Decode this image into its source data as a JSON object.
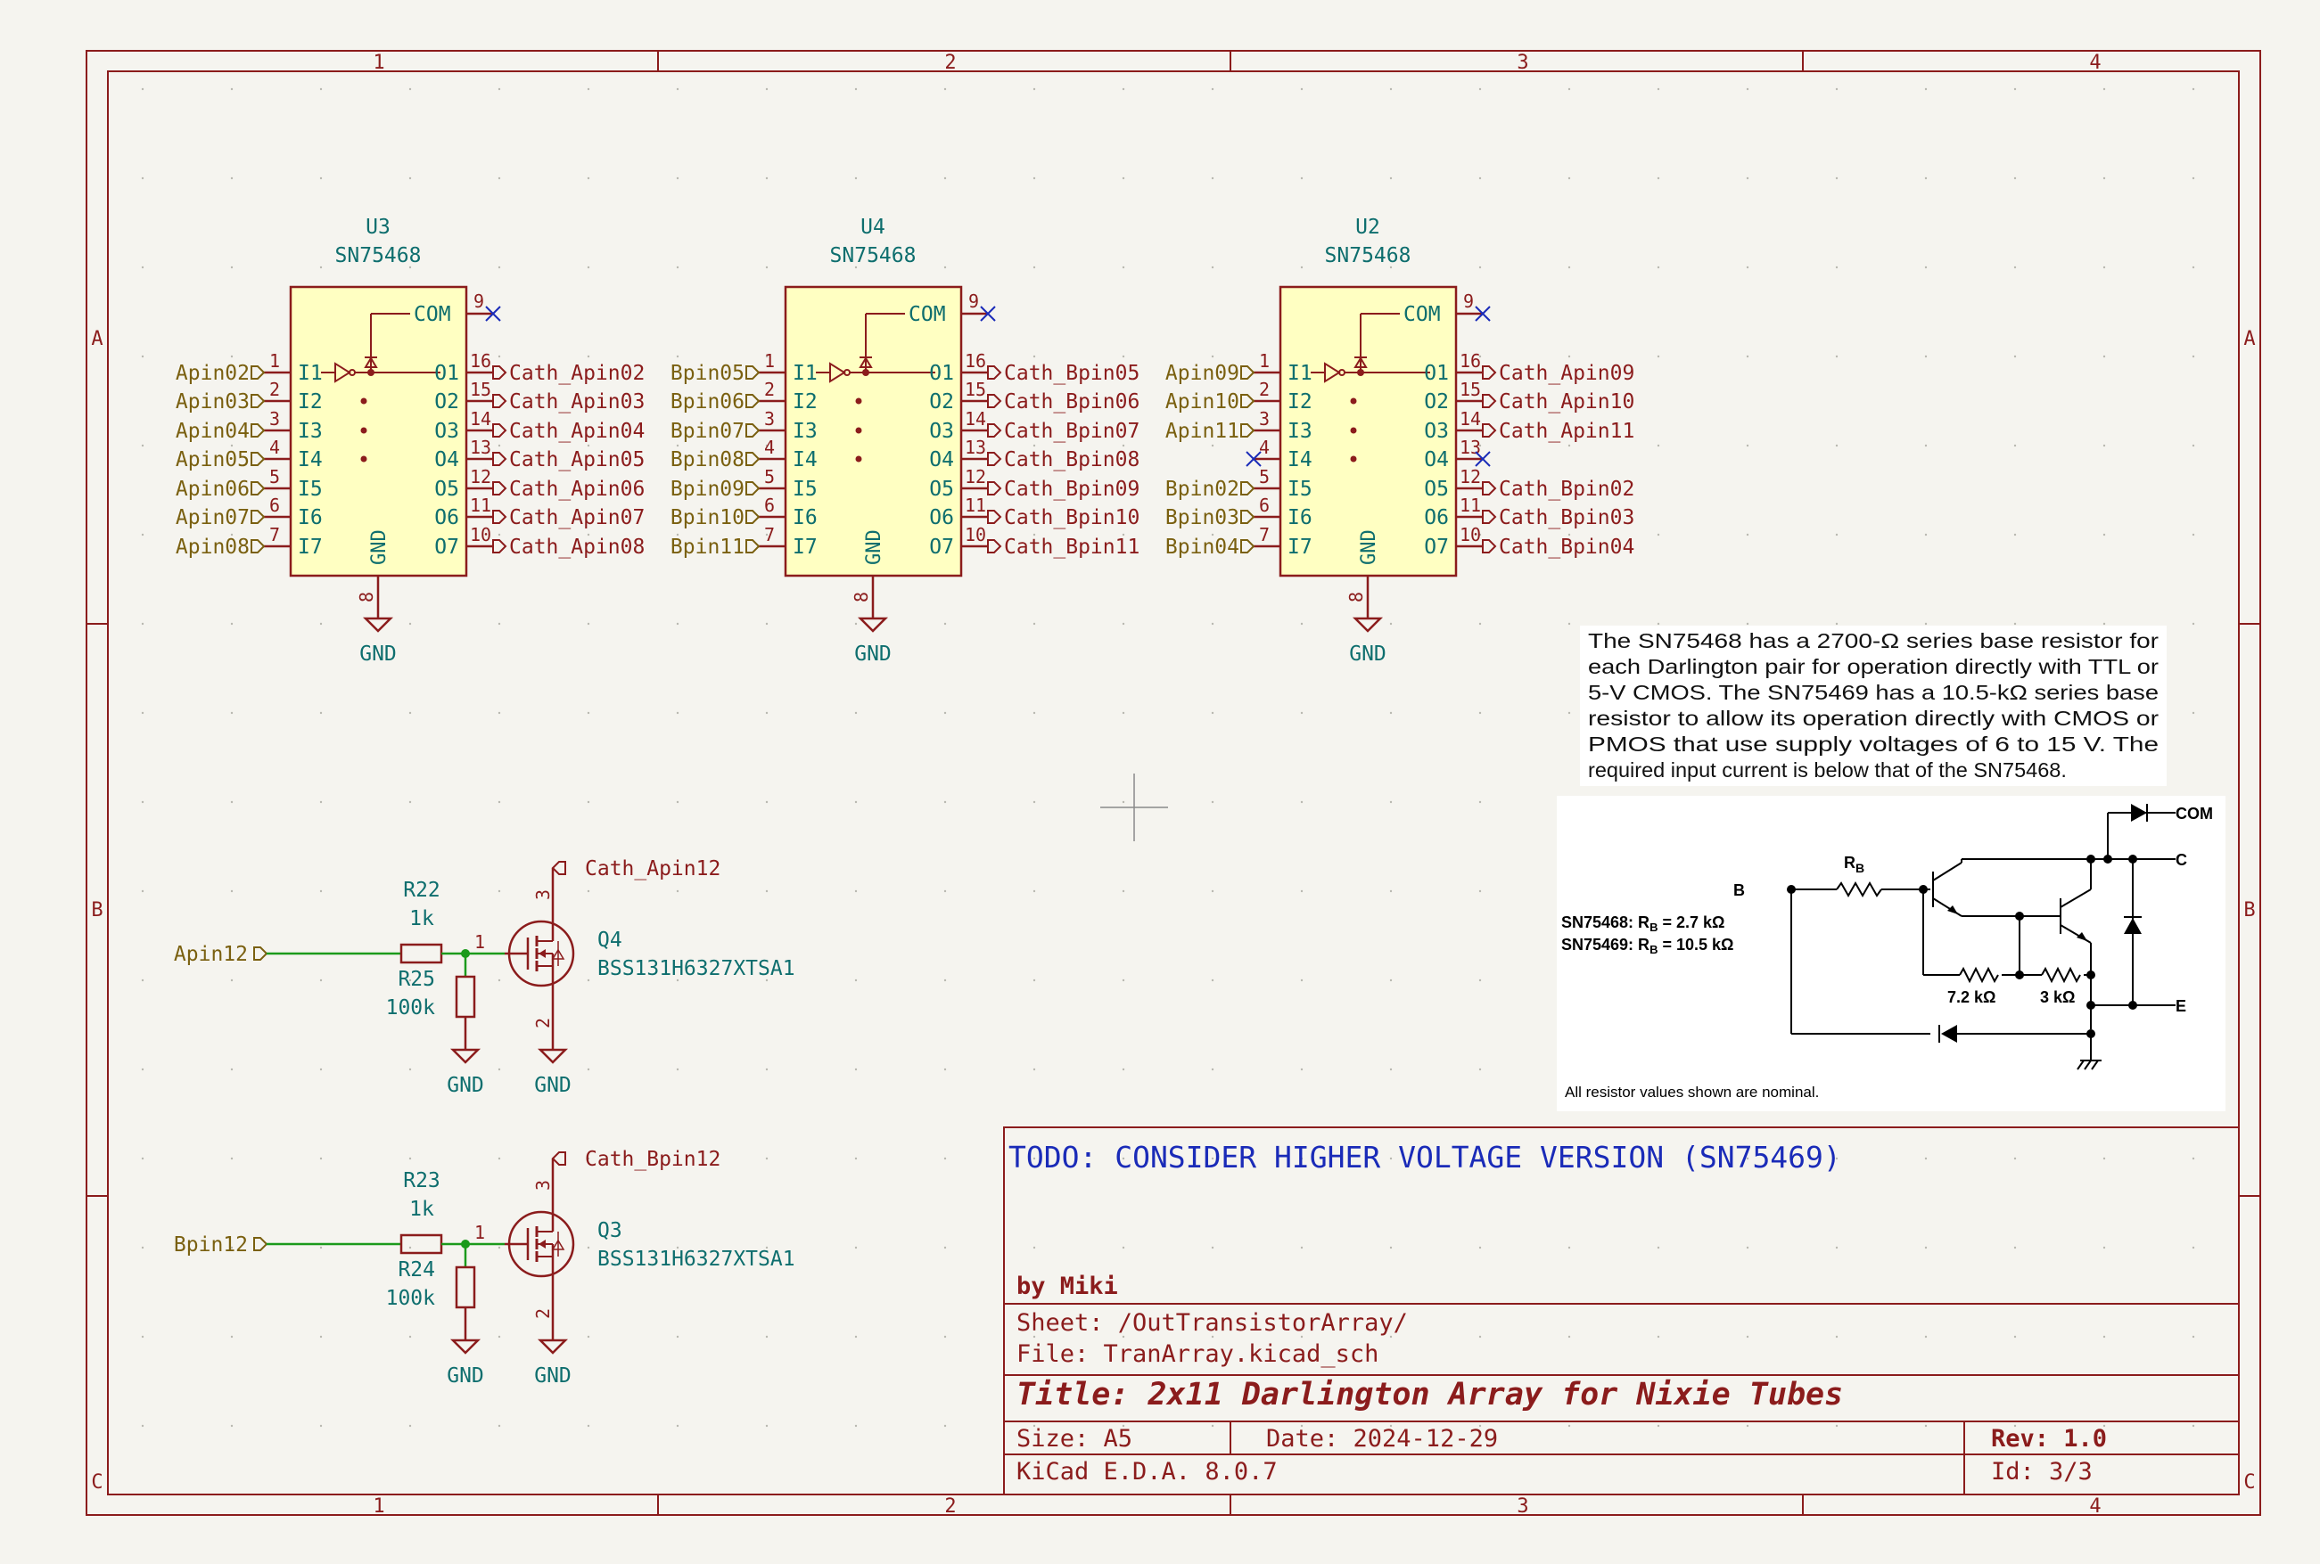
{
  "frame": {
    "columns": [
      "1",
      "2",
      "3",
      "4"
    ],
    "rows": [
      "A",
      "B",
      "C"
    ]
  },
  "ics": [
    {
      "ref": "U3",
      "value": "SN75468",
      "com_label": "COM",
      "com_pin": "9",
      "gnd_label": "GND",
      "gnd_pin": "8",
      "power": "GND",
      "inputs": [
        {
          "pin": "1",
          "name": "I1",
          "net": "Apin02"
        },
        {
          "pin": "2",
          "name": "I2",
          "net": "Apin03"
        },
        {
          "pin": "3",
          "name": "I3",
          "net": "Apin04"
        },
        {
          "pin": "4",
          "name": "I4",
          "net": "Apin05"
        },
        {
          "pin": "5",
          "name": "I5",
          "net": "Apin06"
        },
        {
          "pin": "6",
          "name": "I6",
          "net": "Apin07"
        },
        {
          "pin": "7",
          "name": "I7",
          "net": "Apin08"
        }
      ],
      "outputs": [
        {
          "pin": "16",
          "name": "O1",
          "net": "Cath_Apin02"
        },
        {
          "pin": "15",
          "name": "O2",
          "net": "Cath_Apin03"
        },
        {
          "pin": "14",
          "name": "O3",
          "net": "Cath_Apin04"
        },
        {
          "pin": "13",
          "name": "O4",
          "net": "Cath_Apin05"
        },
        {
          "pin": "12",
          "name": "O5",
          "net": "Cath_Apin06"
        },
        {
          "pin": "11",
          "name": "O6",
          "net": "Cath_Apin07"
        },
        {
          "pin": "10",
          "name": "O7",
          "net": "Cath_Apin08"
        }
      ]
    },
    {
      "ref": "U4",
      "value": "SN75468",
      "com_label": "COM",
      "com_pin": "9",
      "gnd_label": "GND",
      "gnd_pin": "8",
      "power": "GND",
      "inputs": [
        {
          "pin": "1",
          "name": "I1",
          "net": "Bpin05"
        },
        {
          "pin": "2",
          "name": "I2",
          "net": "Bpin06"
        },
        {
          "pin": "3",
          "name": "I3",
          "net": "Bpin07"
        },
        {
          "pin": "4",
          "name": "I4",
          "net": "Bpin08"
        },
        {
          "pin": "5",
          "name": "I5",
          "net": "Bpin09"
        },
        {
          "pin": "6",
          "name": "I6",
          "net": "Bpin10"
        },
        {
          "pin": "7",
          "name": "I7",
          "net": "Bpin11"
        }
      ],
      "outputs": [
        {
          "pin": "16",
          "name": "O1",
          "net": "Cath_Bpin05"
        },
        {
          "pin": "15",
          "name": "O2",
          "net": "Cath_Bpin06"
        },
        {
          "pin": "14",
          "name": "O3",
          "net": "Cath_Bpin07"
        },
        {
          "pin": "13",
          "name": "O4",
          "net": "Cath_Bpin08"
        },
        {
          "pin": "12",
          "name": "O5",
          "net": "Cath_Bpin09"
        },
        {
          "pin": "11",
          "name": "O6",
          "net": "Cath_Bpin10"
        },
        {
          "pin": "10",
          "name": "O7",
          "net": "Cath_Bpin11"
        }
      ]
    },
    {
      "ref": "U2",
      "value": "SN75468",
      "com_label": "COM",
      "com_pin": "9",
      "gnd_label": "GND",
      "gnd_pin": "8",
      "power": "GND",
      "inputs": [
        {
          "pin": "1",
          "name": "I1",
          "net": "Apin09"
        },
        {
          "pin": "2",
          "name": "I2",
          "net": "Apin10"
        },
        {
          "pin": "3",
          "name": "I3",
          "net": "Apin11"
        },
        {
          "pin": "4",
          "name": "I4",
          "net": ""
        },
        {
          "pin": "5",
          "name": "I5",
          "net": "Bpin02"
        },
        {
          "pin": "6",
          "name": "I6",
          "net": "Bpin03"
        },
        {
          "pin": "7",
          "name": "I7",
          "net": "Bpin04"
        }
      ],
      "outputs": [
        {
          "pin": "16",
          "name": "O1",
          "net": "Cath_Apin09"
        },
        {
          "pin": "15",
          "name": "O2",
          "net": "Cath_Apin10"
        },
        {
          "pin": "14",
          "name": "O3",
          "net": "Cath_Apin11"
        },
        {
          "pin": "13",
          "name": "O4",
          "net": ""
        },
        {
          "pin": "12",
          "name": "O5",
          "net": "Cath_Bpin02"
        },
        {
          "pin": "11",
          "name": "O6",
          "net": "Cath_Bpin03"
        },
        {
          "pin": "10",
          "name": "O7",
          "net": "Cath_Bpin04"
        }
      ]
    }
  ],
  "mosfets": [
    {
      "input_net": "Apin12",
      "r_series_ref": "R22",
      "r_series_val": "1k",
      "r_pull_ref": "R25",
      "r_pull_val": "100k",
      "q_ref": "Q4",
      "q_val": "BSS131H6327XTSA1",
      "drain_net": "Cath_Apin12",
      "gate_pin": "1",
      "drain_pin": "3",
      "source_pin": "2",
      "gnd1": "GND",
      "gnd2": "GND"
    },
    {
      "input_net": "Bpin12",
      "r_series_ref": "R23",
      "r_series_val": "1k",
      "r_pull_ref": "R24",
      "r_pull_val": "100k",
      "q_ref": "Q3",
      "q_val": "BSS131H6327XTSA1",
      "drain_net": "Cath_Bpin12",
      "gate_pin": "1",
      "drain_pin": "3",
      "source_pin": "2",
      "gnd1": "GND",
      "gnd2": "GND"
    }
  ],
  "note": {
    "lines": [
      "The SN75468 has a 2700-Ω series base resistor for",
      "each Darlington pair for operation directly with TTL or",
      "5-V CMOS. The SN75469 has a 10.5-kΩ series base",
      "resistor to allow its operation directly with CMOS or",
      "PMOS that use supply voltages of 6 to 15 V. The",
      "required input current is below that of the SN75468."
    ]
  },
  "schematic_image": {
    "com": "COM",
    "b": "B",
    "c": "C",
    "e": "E",
    "rb": "R",
    "rb_sub": "B",
    "line1_a": "SN75468: R",
    "line1_sub": "B",
    "line1_b": " = 2.7 kΩ",
    "line2_a": "SN75469: R",
    "line2_sub": "B",
    "line2_b": " = 10.5 kΩ",
    "r1": "7.2 kΩ",
    "r2": "3 kΩ",
    "footer": "All resistor values shown are nominal."
  },
  "title_block": {
    "todo": "TODO:  CONSIDER HIGHER VOLTAGE VERSION (SN75469)",
    "author": "by Miki",
    "sheet": "Sheet: /OutTransistorArray/",
    "file": "File: TranArray.kicad_sch",
    "title": "Title: 2x11 Darlington Array for Nixie Tubes",
    "size": "Size: A5",
    "date": "Date: 2024-12-29",
    "rev": "Rev: 1.0",
    "tool": "KiCad E.D.A. 8.0.7",
    "id": "Id: 3/3"
  }
}
